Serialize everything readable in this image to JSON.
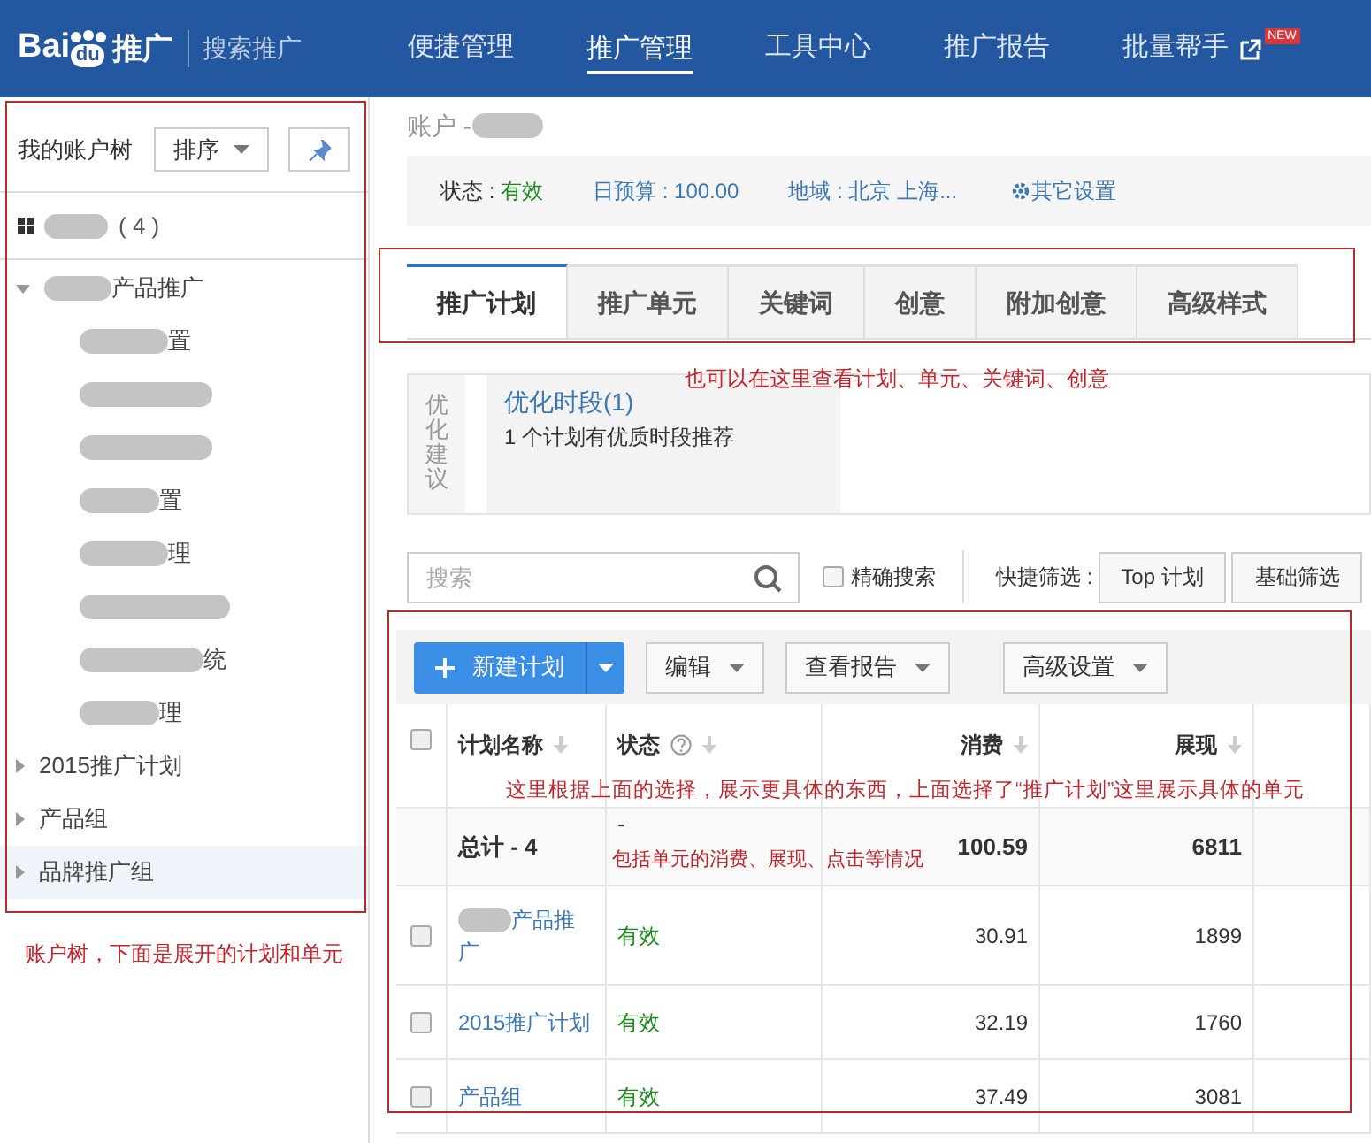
{
  "header": {
    "logo": {
      "left": "Bai",
      "right": "du",
      "product": "推广"
    },
    "subtitle": "搜索推广",
    "nav": [
      {
        "label": "便捷管理",
        "selected": false
      },
      {
        "label": "推广管理",
        "selected": true
      },
      {
        "label": "工具中心",
        "selected": false
      },
      {
        "label": "推广报告",
        "selected": false
      },
      {
        "label": "批量帮手",
        "selected": false,
        "external": true,
        "badge": "NEW"
      }
    ]
  },
  "sidebar": {
    "title": "我的账户树",
    "sort_button": "排序",
    "account": {
      "redacted": true,
      "count": "( 4 )"
    },
    "tree": [
      {
        "label": "产品推广",
        "redacted": true,
        "expanded": true,
        "selected": false,
        "children": [
          {
            "redacted": true,
            "visible_tail": "置",
            "selected": false
          },
          {
            "redacted": true,
            "selected": false
          },
          {
            "redacted": true,
            "selected": false
          },
          {
            "redacted": true,
            "visible_tail": "置",
            "selected": false
          },
          {
            "redacted": true,
            "visible_tail": "理",
            "selected": false
          },
          {
            "redacted": true,
            "selected": false
          },
          {
            "redacted": true,
            "visible_tail": "统",
            "selected": false
          },
          {
            "redacted": true,
            "visible_tail": "理",
            "selected": false
          }
        ]
      },
      {
        "label": "2015推广计划",
        "redacted": false,
        "expanded": false,
        "selected": false
      },
      {
        "label": "产品组",
        "redacted": false,
        "expanded": false,
        "selected": false
      },
      {
        "label": "品牌推广组",
        "redacted": false,
        "expanded": false,
        "selected": true
      }
    ]
  },
  "breadcrumb": {
    "label": "账户 - ",
    "redacted": true
  },
  "info_bar": [
    {
      "kind": "status",
      "label": "状态 : ",
      "value": "有效"
    },
    {
      "kind": "link",
      "text": "日预算 : 100.00"
    },
    {
      "kind": "link",
      "text": "地域 : 北京 上海..."
    },
    {
      "kind": "settings",
      "text": "其它设置"
    }
  ],
  "tabs": [
    {
      "label": "推广计划",
      "selected": true
    },
    {
      "label": "推广单元",
      "selected": false
    },
    {
      "label": "关键词",
      "selected": false
    },
    {
      "label": "创意",
      "selected": false
    },
    {
      "label": "附加创意",
      "selected": false
    },
    {
      "label": "高级样式",
      "selected": false
    }
  ],
  "suggestion": {
    "side_label": "优化建议",
    "title": "优化时段(1)",
    "text": "1 个计划有优质时段推荐"
  },
  "search": {
    "placeholder": "搜索",
    "exact_label": "精确搜索",
    "exact_checked": false,
    "quick_filter_label": "快捷筛选 :",
    "filters": [
      "Top 计划",
      "基础筛选"
    ]
  },
  "toolbar": {
    "primary": "新建计划",
    "buttons": [
      "编辑",
      "查看报告",
      "高级设置"
    ]
  },
  "table": {
    "all_checked": false,
    "columns": [
      {
        "label": "计划名称",
        "help": false
      },
      {
        "label": "状态",
        "help": true
      },
      {
        "label": "消费",
        "help": false
      },
      {
        "label": "展现",
        "help": false
      }
    ],
    "total": {
      "label": "总计 - 4",
      "status": "-",
      "cost": "100.59",
      "impressions": "6811"
    },
    "rows": [
      {
        "name": "产品推广",
        "redacted": true,
        "status": "有效",
        "cost": "30.91",
        "impressions": "1899",
        "checked": false
      },
      {
        "name": "2015推广计划",
        "redacted": false,
        "status": "有效",
        "cost": "32.19",
        "impressions": "1760",
        "checked": false
      },
      {
        "name": "产品组",
        "redacted": false,
        "status": "有效",
        "cost": "37.49",
        "impressions": "3081",
        "checked": false
      }
    ]
  },
  "annotations": {
    "tree": "账户树，下面是展开的计划和单元",
    "tabs": "也可以在这里查看计划、单元、关键词、创意",
    "table": [
      "这里根据上面的选择，展示更具体的东西，上面选择了“推广计划”这里展示具体的单元",
      "包括单元的消费、展现、点击等情况"
    ]
  }
}
